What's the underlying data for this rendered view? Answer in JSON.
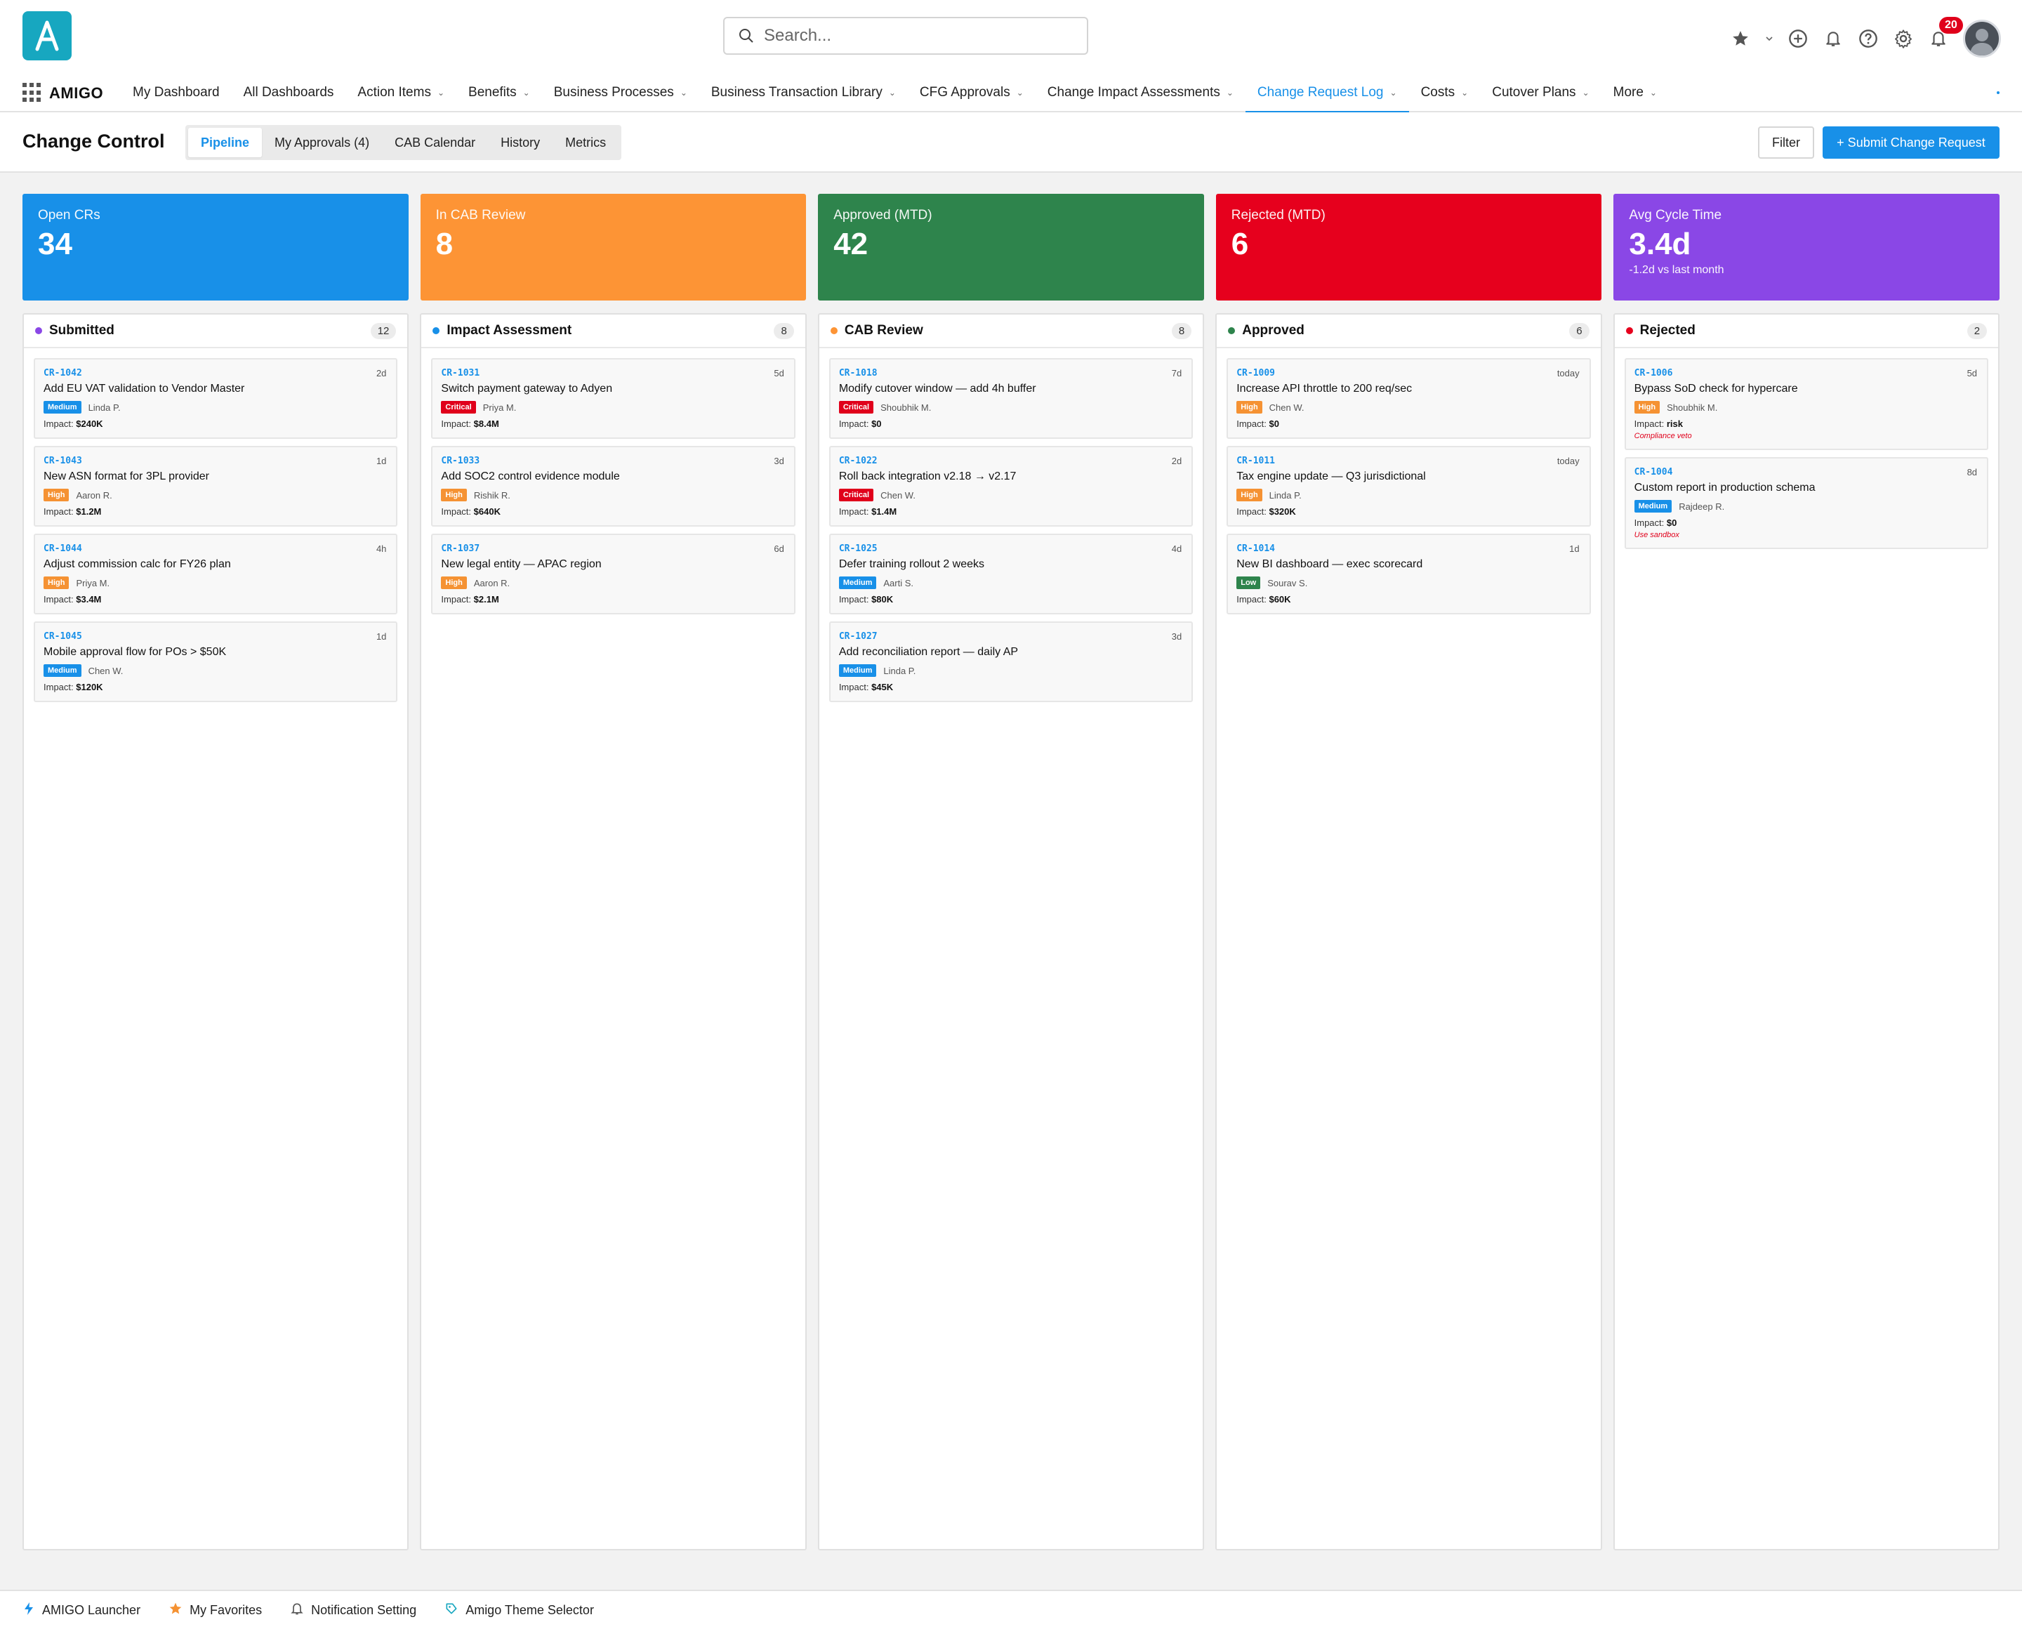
{
  "app": {
    "logo_letter": "A",
    "brand": "AMIGO",
    "search_placeholder": "Search...",
    "notification_count": "20"
  },
  "nav": {
    "items": [
      {
        "label": "My Dashboard",
        "dropdown": false,
        "active": false
      },
      {
        "label": "All Dashboards",
        "dropdown": false,
        "active": false
      },
      {
        "label": "Action Items",
        "dropdown": true,
        "active": false
      },
      {
        "label": "Benefits",
        "dropdown": true,
        "active": false
      },
      {
        "label": "Business Processes",
        "dropdown": true,
        "active": false
      },
      {
        "label": "Business Transaction Library",
        "dropdown": true,
        "active": false
      },
      {
        "label": "CFG Approvals",
        "dropdown": true,
        "active": false
      },
      {
        "label": "Change Impact Assessments",
        "dropdown": true,
        "active": false
      },
      {
        "label": "Change Request Log",
        "dropdown": true,
        "active": true
      },
      {
        "label": "Costs",
        "dropdown": true,
        "active": false
      },
      {
        "label": "Cutover Plans",
        "dropdown": true,
        "active": false
      },
      {
        "label": "More",
        "dropdown": true,
        "active": false
      }
    ]
  },
  "page": {
    "title": "Change Control",
    "tabs": [
      {
        "label": "Pipeline",
        "active": true
      },
      {
        "label": "My Approvals (4)",
        "active": false
      },
      {
        "label": "CAB Calendar",
        "active": false
      },
      {
        "label": "History",
        "active": false
      },
      {
        "label": "Metrics",
        "active": false
      }
    ],
    "filter_label": "Filter",
    "submit_label": "+ Submit Change Request"
  },
  "kpis": [
    {
      "label": "Open CRs",
      "value": "34",
      "sub": "",
      "color": "#1890e8"
    },
    {
      "label": "In CAB Review",
      "value": "8",
      "sub": "",
      "color": "#fd9435"
    },
    {
      "label": "Approved (MTD)",
      "value": "42",
      "sub": "",
      "color": "#2e844c"
    },
    {
      "label": "Rejected (MTD)",
      "value": "6",
      "sub": "",
      "color": "#e6001d"
    },
    {
      "label": "Avg Cycle Time",
      "value": "3.4d",
      "sub": "-1.2d vs last month",
      "color": "#8a47e6"
    }
  ],
  "priority_colors": {
    "Critical": "#e0001b",
    "High": "#f59233",
    "Medium": "#1890e8",
    "Low": "#2e844c"
  },
  "columns": [
    {
      "title": "Submitted",
      "count": "12",
      "dot": "#8a47e6",
      "cards": [
        {
          "id": "CR-1042",
          "age": "2d",
          "title": "Add EU VAT validation to Vendor Master",
          "priority": "Medium",
          "owner": "Linda P.",
          "impact_label": "Impact:",
          "impact": "$240K",
          "note": ""
        },
        {
          "id": "CR-1043",
          "age": "1d",
          "title": "New ASN format for 3PL provider",
          "priority": "High",
          "owner": "Aaron R.",
          "impact_label": "Impact:",
          "impact": "$1.2M",
          "note": ""
        },
        {
          "id": "CR-1044",
          "age": "4h",
          "title": "Adjust commission calc for FY26 plan",
          "priority": "High",
          "owner": "Priya M.",
          "impact_label": "Impact:",
          "impact": "$3.4M",
          "note": ""
        },
        {
          "id": "CR-1045",
          "age": "1d",
          "title": "Mobile approval flow for POs > $50K",
          "priority": "Medium",
          "owner": "Chen W.",
          "impact_label": "Impact:",
          "impact": "$120K",
          "note": ""
        }
      ]
    },
    {
      "title": "Impact Assessment",
      "count": "8",
      "dot": "#1890e8",
      "cards": [
        {
          "id": "CR-1031",
          "age": "5d",
          "title": "Switch payment gateway to Adyen",
          "priority": "Critical",
          "owner": "Priya M.",
          "impact_label": "Impact:",
          "impact": "$8.4M",
          "note": ""
        },
        {
          "id": "CR-1033",
          "age": "3d",
          "title": "Add SOC2 control evidence module",
          "priority": "High",
          "owner": "Rishik R.",
          "impact_label": "Impact:",
          "impact": "$640K",
          "note": ""
        },
        {
          "id": "CR-1037",
          "age": "6d",
          "title": "New legal entity — APAC region",
          "priority": "High",
          "owner": "Aaron R.",
          "impact_label": "Impact:",
          "impact": "$2.1M",
          "note": ""
        }
      ]
    },
    {
      "title": "CAB Review",
      "count": "8",
      "dot": "#fd9435",
      "cards": [
        {
          "id": "CR-1018",
          "age": "7d",
          "title": "Modify cutover window — add 4h buffer",
          "priority": "Critical",
          "owner": "Shoubhik M.",
          "impact_label": "Impact:",
          "impact": "$0",
          "note": ""
        },
        {
          "id": "CR-1022",
          "age": "2d",
          "title": "Roll back integration v2.18 → v2.17",
          "priority": "Critical",
          "owner": "Chen W.",
          "impact_label": "Impact:",
          "impact": "$1.4M",
          "note": ""
        },
        {
          "id": "CR-1025",
          "age": "4d",
          "title": "Defer training rollout 2 weeks",
          "priority": "Medium",
          "owner": "Aarti S.",
          "impact_label": "Impact:",
          "impact": "$80K",
          "note": ""
        },
        {
          "id": "CR-1027",
          "age": "3d",
          "title": "Add reconciliation report — daily AP",
          "priority": "Medium",
          "owner": "Linda P.",
          "impact_label": "Impact:",
          "impact": "$45K",
          "note": ""
        }
      ]
    },
    {
      "title": "Approved",
      "count": "6",
      "dot": "#2e844c",
      "cards": [
        {
          "id": "CR-1009",
          "age": "today",
          "title": "Increase API throttle to 200 req/sec",
          "priority": "High",
          "owner": "Chen W.",
          "impact_label": "Impact:",
          "impact": "$0",
          "note": ""
        },
        {
          "id": "CR-1011",
          "age": "today",
          "title": "Tax engine update — Q3 jurisdictional",
          "priority": "High",
          "owner": "Linda P.",
          "impact_label": "Impact:",
          "impact": "$320K",
          "note": ""
        },
        {
          "id": "CR-1014",
          "age": "1d",
          "title": "New BI dashboard — exec scorecard",
          "priority": "Low",
          "owner": "Sourav S.",
          "impact_label": "Impact:",
          "impact": "$60K",
          "note": ""
        }
      ]
    },
    {
      "title": "Rejected",
      "count": "2",
      "dot": "#e6001d",
      "cards": [
        {
          "id": "CR-1006",
          "age": "5d",
          "title": "Bypass SoD check for hypercare",
          "priority": "High",
          "owner": "Shoubhik M.",
          "impact_label": "Impact:",
          "impact": "risk",
          "note": "Compliance veto"
        },
        {
          "id": "CR-1004",
          "age": "8d",
          "title": "Custom report in production schema",
          "priority": "Medium",
          "owner": "Rajdeep R.",
          "impact_label": "Impact:",
          "impact": "$0",
          "note": "Use sandbox"
        }
      ]
    }
  ],
  "footer": {
    "items": [
      {
        "label": "AMIGO Launcher",
        "icon": "lightning-icon"
      },
      {
        "label": "My Favorites",
        "icon": "star-icon"
      },
      {
        "label": "Notification Setting",
        "icon": "bell-icon"
      },
      {
        "label": "Amigo Theme Selector",
        "icon": "palette-icon"
      }
    ]
  }
}
